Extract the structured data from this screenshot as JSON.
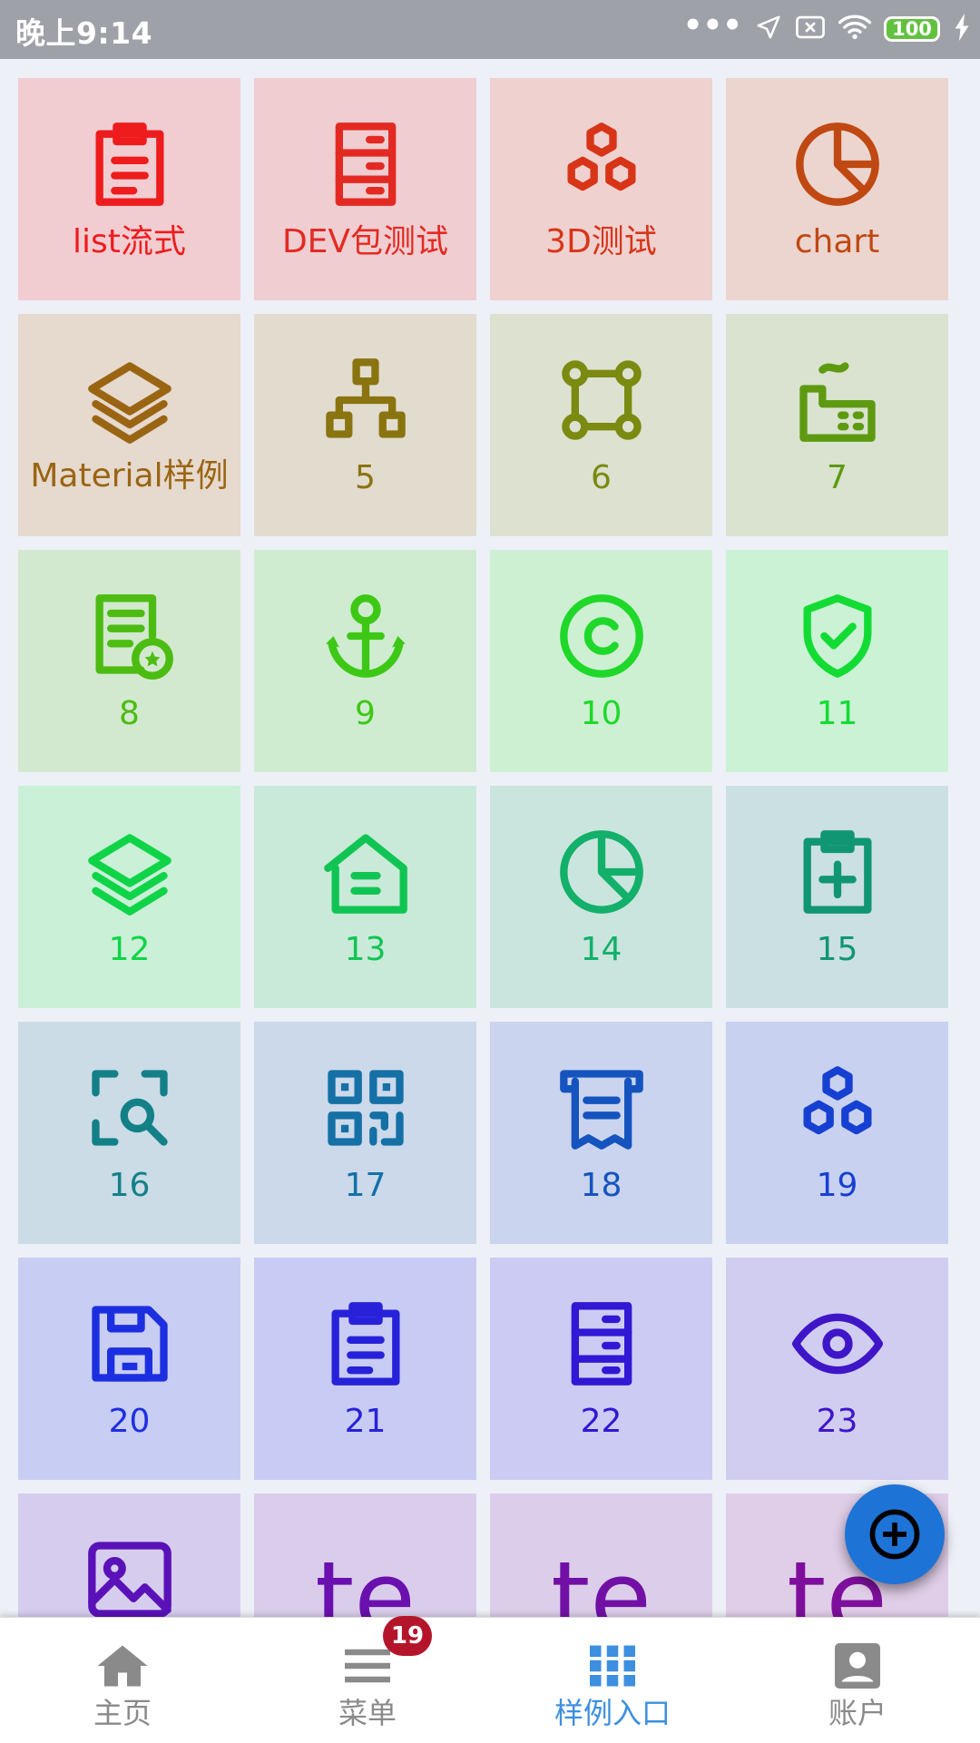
{
  "status_bar": {
    "time": "晚上9:14",
    "dots": "•••",
    "battery": "100"
  },
  "tiles": [
    {
      "label": "list流式",
      "icon": "clipboard-icon",
      "color": "#ee1c1c",
      "bg": "#f1cdd2"
    },
    {
      "label": "DEV包测试",
      "icon": "archive-drawer-icon",
      "color": "#e32a22",
      "bg": "#f0cdd1"
    },
    {
      "label": "3D测试",
      "icon": "hexagons-icon",
      "color": "#d83518",
      "bg": "#efd1d0"
    },
    {
      "label": "chart",
      "icon": "pie-chart-icon",
      "color": "#c04812",
      "bg": "#ecd5cf"
    },
    {
      "label": "Material样例",
      "icon": "layers-icon",
      "color": "#9a6512",
      "bg": "#e6d9ce"
    },
    {
      "label": "5",
      "icon": "hierarchy-icon",
      "color": "#8a7410",
      "bg": "#e2dccf"
    },
    {
      "label": "6",
      "icon": "vector-square-icon",
      "color": "#7b8a10",
      "bg": "#dde1cf"
    },
    {
      "label": "7",
      "icon": "factory-icon",
      "color": "#5e9a10",
      "bg": "#d9e3cf"
    },
    {
      "label": "8",
      "icon": "certificate-icon",
      "color": "#4cbc12",
      "bg": "#d3e9cf"
    },
    {
      "label": "9",
      "icon": "anchor-icon",
      "color": "#3dc816",
      "bg": "#cfecd0"
    },
    {
      "label": "10",
      "icon": "copyright-icon",
      "color": "#1fd82a",
      "bg": "#cdf0d2"
    },
    {
      "label": "11",
      "icon": "shield-check-icon",
      "color": "#12dc34",
      "bg": "#cbf2d4"
    },
    {
      "label": "12",
      "icon": "layers-icon",
      "color": "#10d448",
      "bg": "#caf0d8"
    },
    {
      "label": "13",
      "icon": "home-icon",
      "color": "#10c454",
      "bg": "#c9ead9"
    },
    {
      "label": "14",
      "icon": "pie-chart-icon",
      "color": "#12b06a",
      "bg": "#cae5dd"
    },
    {
      "label": "15",
      "icon": "clipboard-plus-icon",
      "color": "#119673",
      "bg": "#cbe0e2"
    },
    {
      "label": "16",
      "icon": "scan-search-icon",
      "color": "#138088",
      "bg": "#cbdce7"
    },
    {
      "label": "17",
      "icon": "qrcode-icon",
      "color": "#1570a6",
      "bg": "#cbd9ea"
    },
    {
      "label": "18",
      "icon": "receipt-icon",
      "color": "#1554bf",
      "bg": "#cad4ee"
    },
    {
      "label": "19",
      "icon": "hexagons-icon",
      "color": "#1540d2",
      "bg": "#c9d1f0"
    },
    {
      "label": "20",
      "icon": "floppy-icon",
      "color": "#1c2fe0",
      "bg": "#c8cdf3"
    },
    {
      "label": "21",
      "icon": "clipboard-icon",
      "color": "#2722d9",
      "bg": "#c8cbf4"
    },
    {
      "label": "22",
      "icon": "archive-drawer-icon",
      "color": "#3018d4",
      "bg": "#cccbf3"
    },
    {
      "label": "23",
      "icon": "eye-icon",
      "color": "#3e16c8",
      "bg": "#d1cdf1"
    },
    {
      "label": "",
      "icon": "image-icon",
      "color": "#5a12b8",
      "bg": "#d6cdee"
    },
    {
      "label": "te",
      "icon": "",
      "color": "#6a10ae",
      "bg": "#dacdec"
    },
    {
      "label": "te",
      "icon": "",
      "color": "#7210a5",
      "bg": "#dcceea"
    },
    {
      "label": "te",
      "icon": "",
      "color": "#7e0f9c",
      "bg": "#e0cee8"
    }
  ],
  "fab": {
    "icon": "add-circle-icon"
  },
  "bottom_nav": {
    "items": [
      {
        "label": "主页",
        "icon": "home-icon",
        "active": false
      },
      {
        "label": "菜单",
        "icon": "menu-icon",
        "active": false
      },
      {
        "label": "样例入口",
        "icon": "apps-grid-icon",
        "active": true
      },
      {
        "label": "账户",
        "icon": "account-box-icon",
        "active": false
      }
    ],
    "badge": "19",
    "active_color": "#3d8fe0",
    "inactive_color": "#8a8a8a"
  }
}
